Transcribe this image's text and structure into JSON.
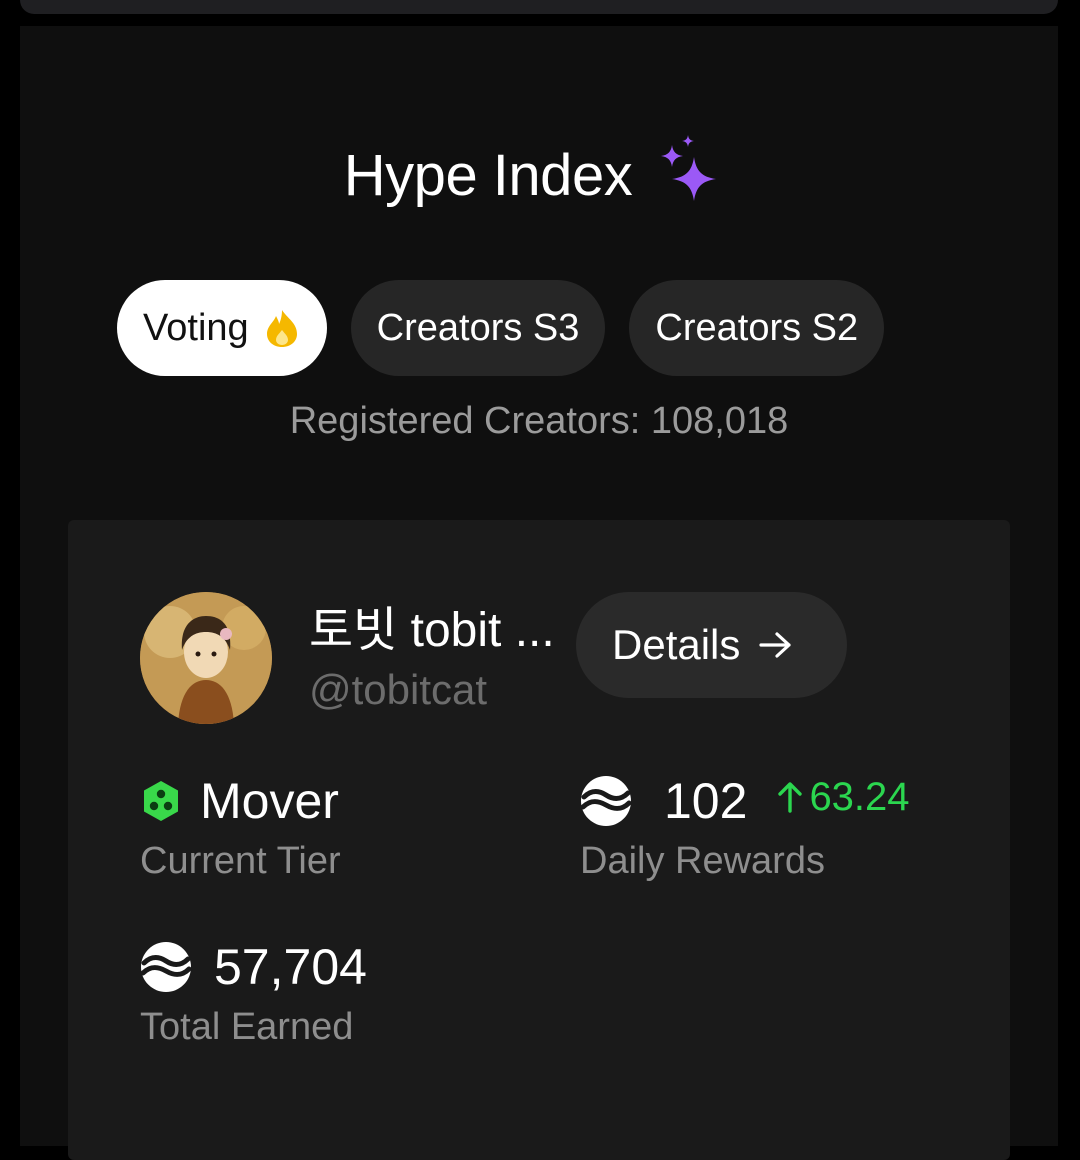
{
  "header": {
    "title": "Hype Index"
  },
  "tabs": [
    {
      "label": "Voting",
      "active": true
    },
    {
      "label": "Creators S3",
      "active": false
    },
    {
      "label": "Creators S2",
      "active": false
    }
  ],
  "registered": {
    "text": "Registered Creators: 108,018"
  },
  "creator": {
    "name": "토빗 tobit ...",
    "handle": "@tobitcat",
    "details_label": "Details"
  },
  "stats": {
    "tier": {
      "value": "Mover",
      "label": "Current Tier"
    },
    "daily_rewards": {
      "value": "102",
      "delta": "63.24",
      "label": "Daily Rewards"
    },
    "total_earned": {
      "value": "57,704",
      "label": "Total Earned"
    }
  },
  "colors": {
    "accent_purple": "#9b59f6",
    "flame_yellow": "#f5b800",
    "positive_green": "#2bd64f",
    "tier_green": "#39d84a"
  },
  "icons": {
    "title_icon": "sparkles-icon",
    "voting_icon": "flame-icon",
    "details_icon": "arrow-right-icon",
    "tier_icon": "hexagon-tier-icon",
    "reward_icon": "coin-icon",
    "delta_icon": "arrow-up-icon"
  }
}
